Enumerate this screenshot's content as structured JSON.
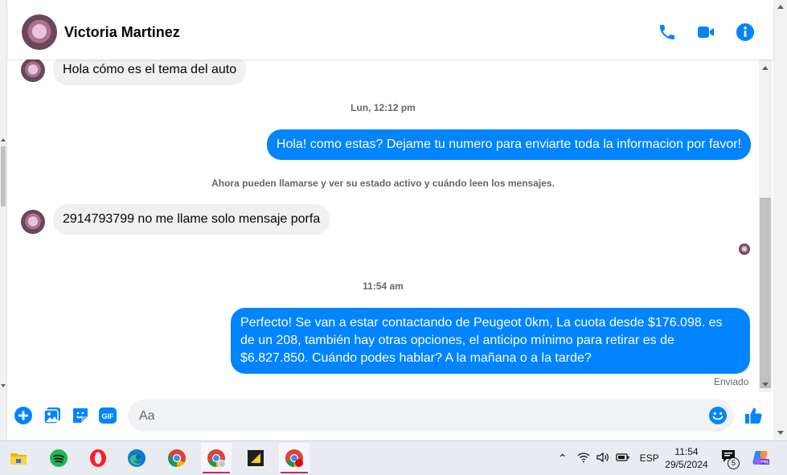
{
  "contact": {
    "name": "Victoria Martinez"
  },
  "header_icons": [
    "phone-icon",
    "video-camera-icon",
    "info-icon"
  ],
  "messages": [
    {
      "direction": "incoming",
      "text": "Hola cómo es el tema del auto"
    },
    {
      "type": "timestamp",
      "text": "Lun, 12:12 pm"
    },
    {
      "direction": "outgoing",
      "text": "Hola! como estas? Dejame tu numero para enviarte toda la informacion por favor!"
    },
    {
      "type": "system",
      "text": "Ahora pueden llamarse y ver su estado activo y cuándo leen los mensajes."
    },
    {
      "direction": "incoming",
      "text": "2914793799 no me llame solo mensaje porfa"
    },
    {
      "type": "timestamp",
      "text": "11:54 am"
    },
    {
      "direction": "outgoing",
      "lines": [
        "Perfecto!  Se van a estar contactando de Peugeot 0km, La cuota desde $176.098. es",
        "de un 208, también hay otras opciones, el anticipo mínimo para retirar es de",
        "$6.827.850. Cuándo podes hablar? A la mañana o a la tarde?"
      ]
    }
  ],
  "delivery_status": "Enviado",
  "composer": {
    "placeholder": "Aa",
    "icons": [
      "plus-icon",
      "photo-icon",
      "sticker-icon",
      "gif-icon",
      "emoji-icon",
      "thumbs-up-icon"
    ],
    "gif_label": "GIF"
  },
  "colors": {
    "accent": "#0084ff",
    "incoming_bubble": "#f0f0f0",
    "meta_text": "#65676b"
  },
  "taskbar": {
    "apps": [
      "file-explorer",
      "spotify",
      "opera",
      "edge",
      "chrome",
      "chrome-profile",
      "sticky-app",
      "chrome-notification"
    ],
    "tray": {
      "language": "ESP",
      "time": "11:54",
      "date": "29/5/2024",
      "notification_count": "5"
    }
  }
}
